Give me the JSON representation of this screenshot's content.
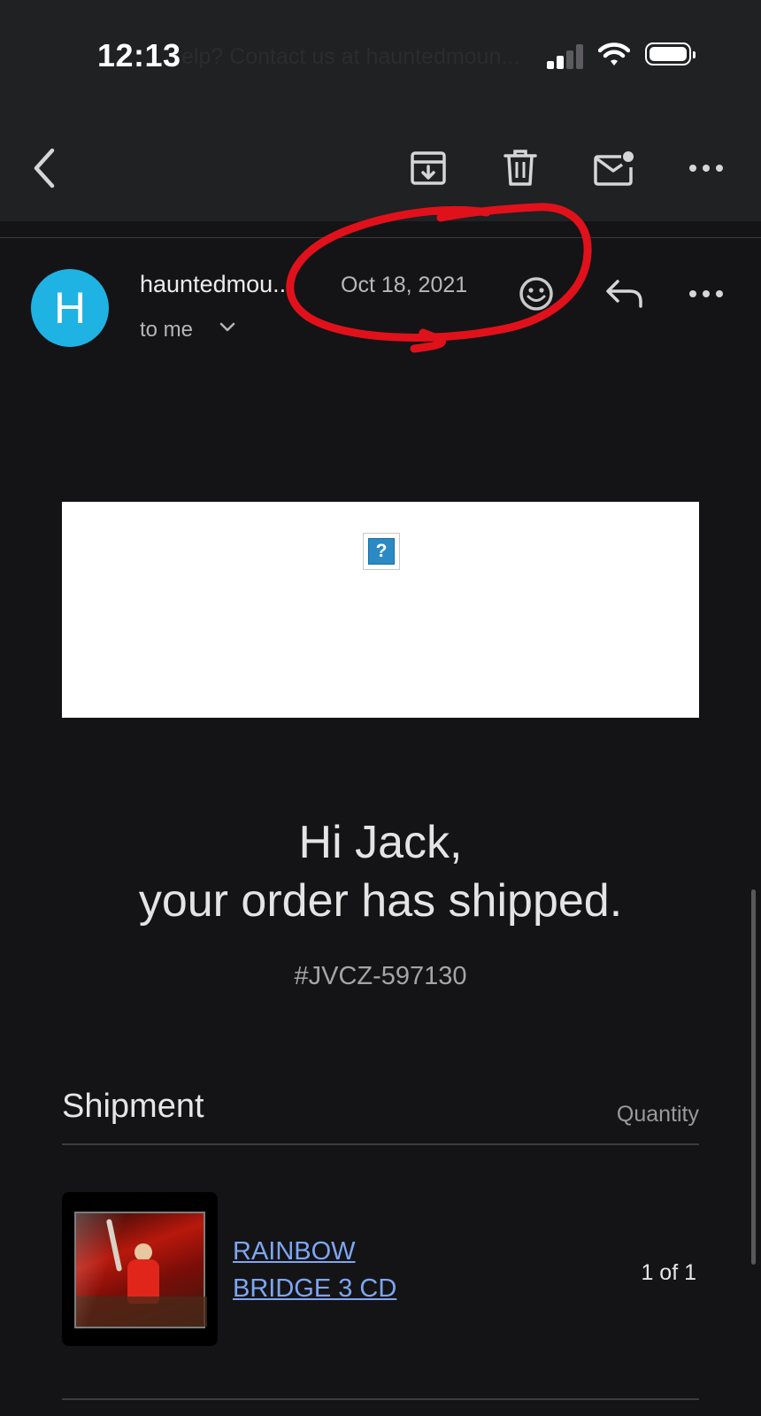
{
  "status_bar": {
    "time": "12:13",
    "ghost_text": "elp? Contact us at hauntedmoun..."
  },
  "toolbar": {
    "back_icon": "chevron-left-icon",
    "archive_icon": "archive-icon",
    "delete_icon": "trash-icon",
    "mark_unread_icon": "mail-unread-icon",
    "more_icon": "more-horizontal-icon"
  },
  "message": {
    "avatar_letter": "H",
    "avatar_color": "#1fb3e4",
    "sender": "hauntedmou...",
    "date": "Oct 18, 2021",
    "recipient": "to me",
    "annotation_color": "#e0111b"
  },
  "email": {
    "greeting_line1": "Hi Jack,",
    "greeting_line2": "your order has shipped.",
    "order_number": "#JVCZ-597130",
    "broken_image_glyph": "?",
    "shipment": {
      "title": "Shipment",
      "quantity_header": "Quantity",
      "items": [
        {
          "name_line1": "RAINBOW",
          "name_line2": "BRIDGE 3 CD",
          "quantity": "1 of 1"
        }
      ]
    }
  }
}
